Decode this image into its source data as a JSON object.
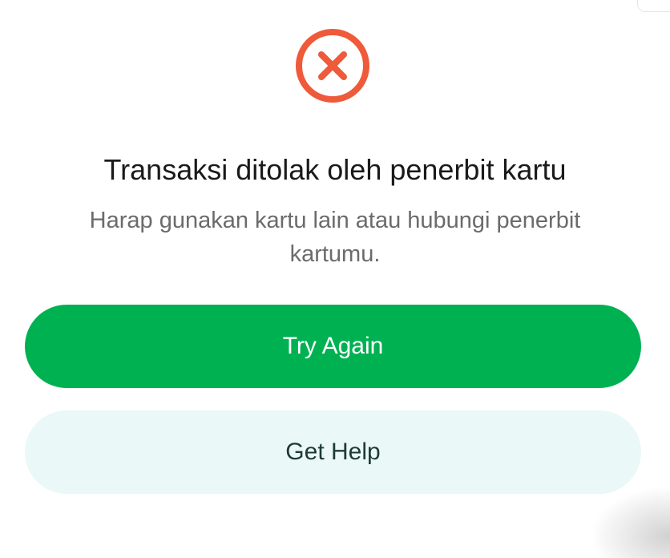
{
  "dialog": {
    "icon": "error-x-circle-icon",
    "title": "Transaksi ditolak oleh penerbit kartu",
    "message": "Harap gunakan kartu lain atau hubungi penerbit kartumu.",
    "primary_button": "Try Again",
    "secondary_button": "Get Help"
  },
  "colors": {
    "error": "#ee5a3a",
    "primary": "#00b152",
    "secondary_bg": "#eaf8f7",
    "secondary_text": "#1f3a35"
  }
}
